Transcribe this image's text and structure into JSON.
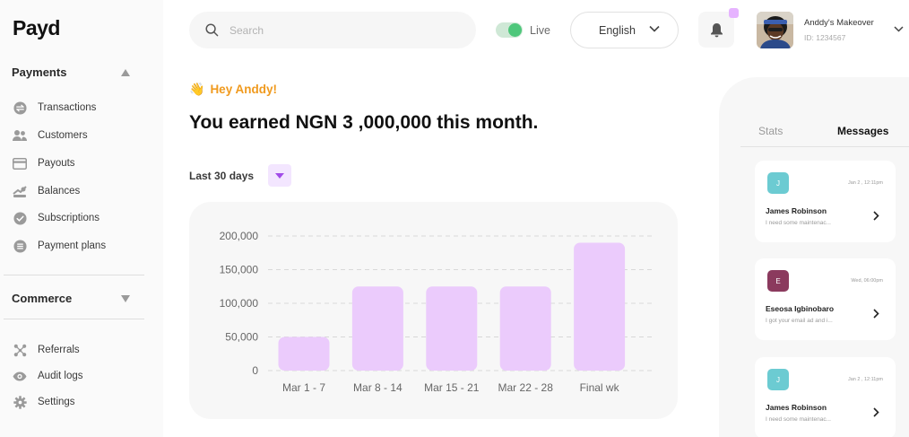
{
  "brand": {
    "name": "Payd"
  },
  "sidebar": {
    "sections": [
      {
        "title": "Payments",
        "expanded": true,
        "items": [
          {
            "label": "Transactions",
            "icon": "transactions-icon"
          },
          {
            "label": "Customers",
            "icon": "customers-icon"
          },
          {
            "label": "Payouts",
            "icon": "card-icon"
          },
          {
            "label": "Balances",
            "icon": "balances-icon"
          },
          {
            "label": "Subscriptions",
            "icon": "check-circle-icon"
          },
          {
            "label": "Payment plans",
            "icon": "stack-icon"
          }
        ]
      },
      {
        "title": "Commerce",
        "expanded": false,
        "items": []
      }
    ],
    "bottom_items": [
      {
        "label": "Referrals",
        "icon": "referrals-icon"
      },
      {
        "label": "Audit logs",
        "icon": "eye-icon"
      },
      {
        "label": "Settings",
        "icon": "gear-icon"
      }
    ]
  },
  "header": {
    "search_placeholder": "Search",
    "live_label": "Live",
    "live_enabled": true,
    "language": "English",
    "notification_badge": true,
    "user": {
      "name": "Anddy's Makeover",
      "id": "ID: 1234567"
    }
  },
  "main": {
    "greeting_emoji": "👋",
    "greeting": "Hey Anddy!",
    "headline": "You earned NGN 3 ,000,000 this month.",
    "period": "Last 30 days"
  },
  "chart_data": {
    "type": "bar",
    "categories": [
      "Mar 1 - 7",
      "Mar 8 - 14",
      "Mar 15 - 21",
      "Mar 22 - 28",
      "Final wk"
    ],
    "values": [
      50000,
      125000,
      125000,
      125000,
      190000
    ],
    "y_ticks": [
      0,
      50000,
      100000,
      150000,
      200000
    ],
    "y_tick_labels": [
      "0",
      "50,000",
      "100,000",
      "150,000",
      "200,000"
    ],
    "ylim": [
      0,
      200000
    ],
    "grid": true,
    "bar_color": "#ebcbfc"
  },
  "panel": {
    "tabs": [
      {
        "label": "Stats",
        "active": false
      },
      {
        "label": "Messages",
        "active": true
      }
    ],
    "messages": [
      {
        "initial": "J",
        "name": "James Robinson",
        "time": "Jan 2 , 12:11pm",
        "preview": "I need some maintenac...",
        "color": "#6ccbd2"
      },
      {
        "initial": "E",
        "name": "Eseosa Igbinobaro",
        "time": "Wed, 06:00pm",
        "preview": "I got your email ad and i...",
        "color": "#8b3a5e"
      },
      {
        "initial": "J",
        "name": "James Robinson",
        "time": "Jan 2 , 12:11pm",
        "preview": "I need some maintenac...",
        "color": "#6ccbd2"
      }
    ]
  }
}
